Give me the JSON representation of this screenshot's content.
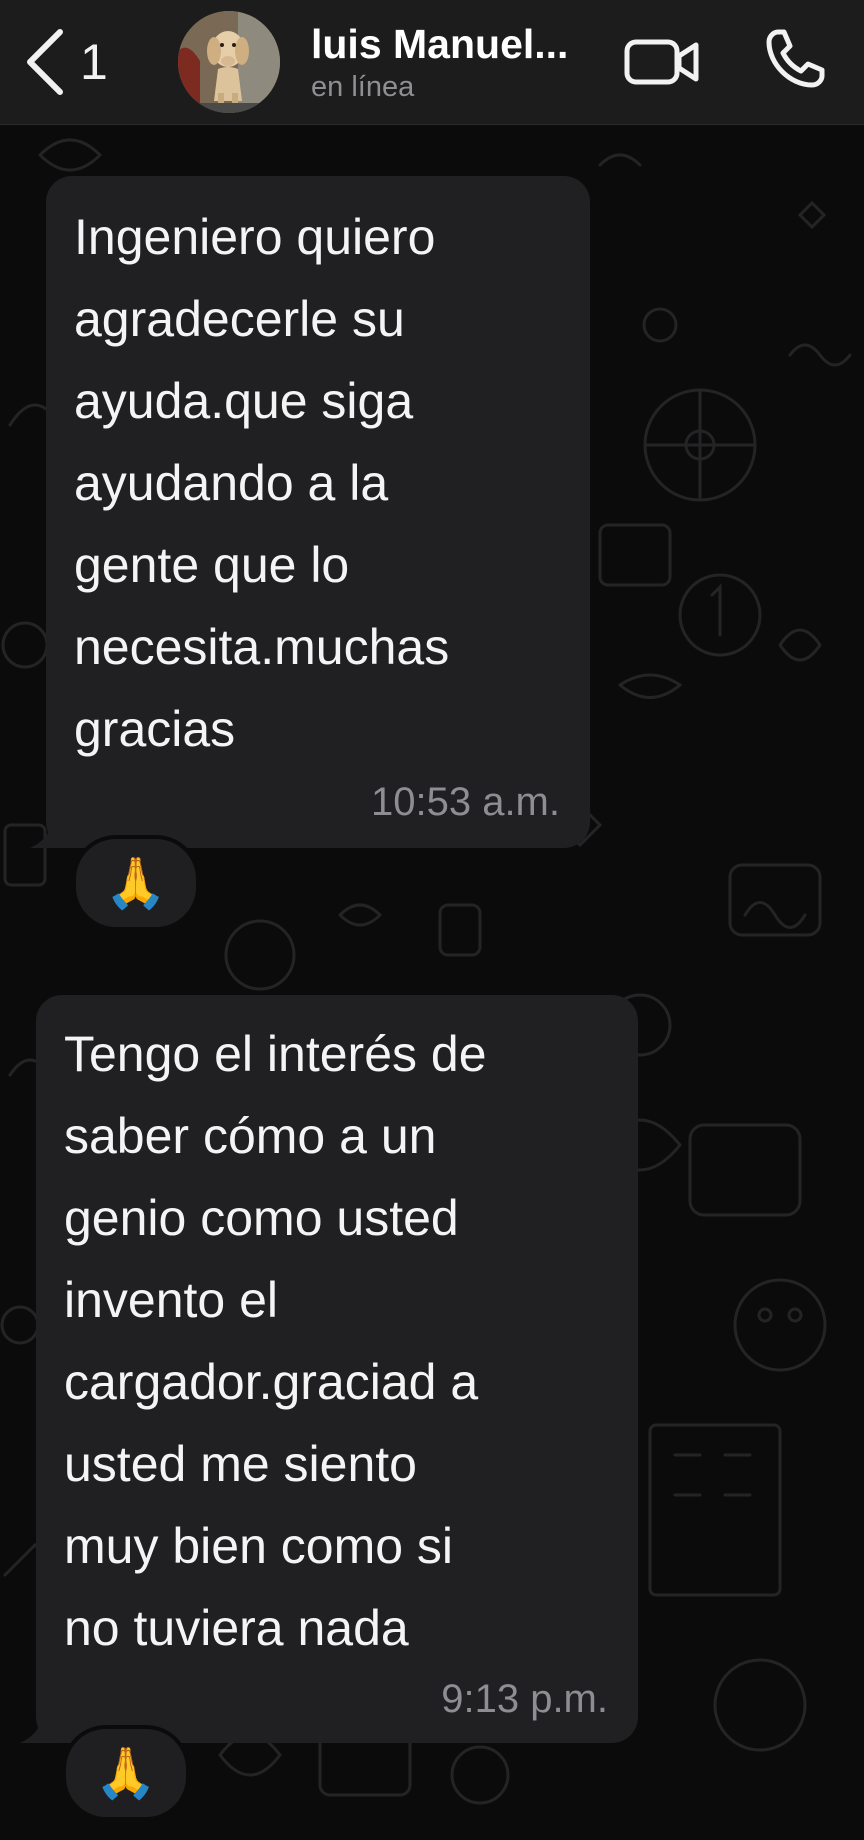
{
  "header": {
    "unread_count": "1",
    "contact_name": "luis Manuel...",
    "status": "en línea"
  },
  "messages": [
    {
      "text": "Ingeniero quiero\nagradecerle su\nayuda.que siga\nayudando a la\ngente que lo\nnecesita.muchas\ngracias",
      "time": "10:53 a.m.",
      "reaction": "🙏"
    },
    {
      "text": "Tengo el interés de\nsaber cómo a un\ngenio como usted\ninvento el\ncargador.graciad a\nusted me siento\nmuy bien como si\nno tuviera nada",
      "time": "9:13 p.m.",
      "reaction": "🙏"
    }
  ],
  "icons": {
    "back": "chevron-left-icon",
    "video": "video-camera-icon",
    "call": "phone-icon"
  },
  "colors": {
    "header_bg": "#1c1c1d",
    "bubble_bg": "#202022",
    "chat_bg": "#0b0b0b",
    "timestamp": "#8d8d92"
  }
}
